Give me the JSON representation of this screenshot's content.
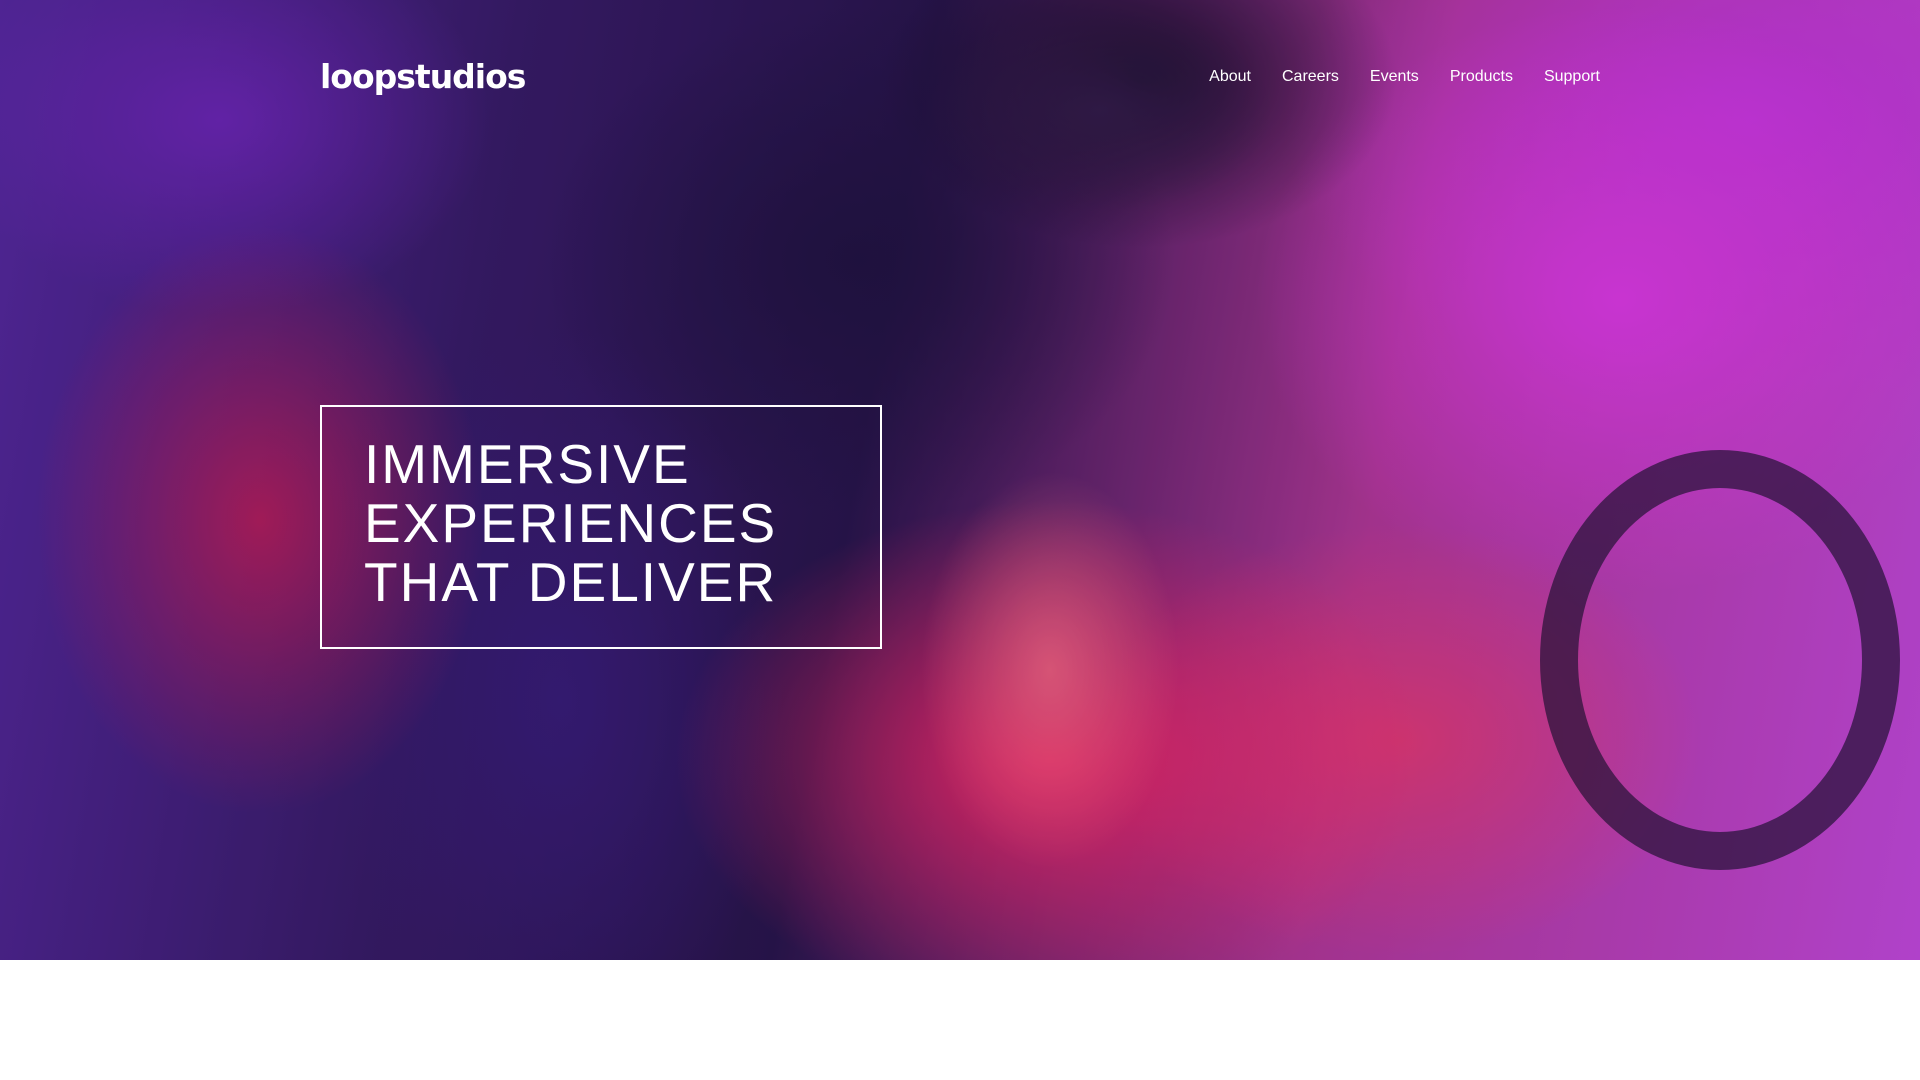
{
  "header": {
    "logo_text": "loopstudios",
    "nav": [
      {
        "label": "About"
      },
      {
        "label": "Careers"
      },
      {
        "label": "Events"
      },
      {
        "label": "Products"
      },
      {
        "label": "Support"
      }
    ]
  },
  "hero": {
    "headline": "IMMERSIVE EXPERIENCES THAT DELIVER",
    "background_image": "vr-headset-person-steering-wheel-neon"
  },
  "colors": {
    "text": "#ffffff",
    "page_background": "#ffffff",
    "hero_magenta": "#c94be6",
    "hero_pink": "#ff2870",
    "hero_blue": "#3b1d6e"
  }
}
